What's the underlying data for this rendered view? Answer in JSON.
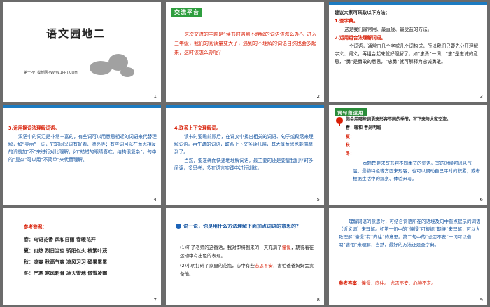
{
  "slides": [
    {
      "num": "1",
      "title": "语文园地二",
      "subtitle": "第一PPT模板网-WWW.1PPT.COM"
    },
    {
      "num": "2",
      "tag": "交流平台",
      "body": "这次交流的主题是“读书时遇到不理解的词语该怎么办”。进入三年级，我们的阅读量变大了，遇到的不理解的词语自然也会多起来，这时该怎么办呢？"
    },
    {
      "num": "3",
      "intro": "建议大家可采取以下方法：",
      "m1": "1.查字典。",
      "m1b": "这是我们最常用、最直接、最受益的方法。",
      "m2": "2.运用组合法理解词语。",
      "m2b": "一个词语，通常由几个字或几个词构成，所以我们只要先分开理解字义、词义，再组合起来就好理解了。如“忠勇”一词，“忠”是忠诚的意思，“勇”是勇敢的意思，“忠勇”就可解释为忠诚勇敢。"
    },
    {
      "num": "4",
      "m3": "3.运用换词法理解词语。",
      "m3b": "汉语中的词汇是非常丰富的，有些词可以用意思相近的词语来代替理解，如“美丽”一词，它的同义词有好看、漂亮等；有些词可以在意思相反的词前加“不”来进行对比理解，如“蜡蜡的眼睛喜欢，结构很复杂”，句中的“复杂”可以用“不简单”来代替理解。"
    },
    {
      "num": "5",
      "m4": "4.联系上下文理解词。",
      "m4b": "读书时要瞻前顾后，在课文中找出相关的词语、句子或段落来理解词语。再生疏的词语，联系上下文多读几遍，其大概意思也能揣摩到了。",
      "m4c": "当然，要准确而快速地理解词语，最主要的还是要靠我们平时多阅读，多思考，多在语言实践中进行训练。"
    },
    {
      "num": "6",
      "tag": "词句段运用",
      "q": "你会用哪些词语来形容不同的季节，写下来与大家交流。",
      "l1": "春：暖和  春光明媚",
      "l2": "夏：",
      "l3": "秋：",
      "l4": "冬：",
      "note": "本题是要求写形容不同季节的词语。写的时候可以从气温、景物特色等方面来形容，也可以调动自己平时的积累，或者根据生活中的观察、体验来写。"
    },
    {
      "num": "7",
      "head": "参考答案：",
      "a1": "春：鸟语花香  风和日丽  春暖花开",
      "a2": "夏：炎热  烈日当空  骄阳似火  枝繁叶茂",
      "a3": "秋：凉爽  秋高气爽  凉风习习  硕果累累",
      "a4": "冬：严寒  寒风刺骨  冰天雪地  傲雪凌霜"
    },
    {
      "num": "8",
      "q": "说一说，你是用什么方法理解下面加点词语的意思的？",
      "s1a": "(1)听了老师的这番话，我对即将到来的一天充满了",
      "s1w": "憧憬",
      "s1b": "，期待着在运动中有出色的表现。",
      "s2a": "(2)小明打碎了家里的花瓶，心中有些",
      "s2w": "忐忑不安",
      "s2b": "，害怕爸爸妈妈会责备他。"
    },
    {
      "num": "9",
      "body": "理解词语的意思时，可结合词语所在的语境及句中重点提示的词语（近义词）来理解。如第一句中的“憧憬”可根据“期待”来理解，可以大致理解“憧憬”有“向往”的意思。第二句中的“忐忑不安”一词可以借助“害怕”来理解，当然，最好的方法还是查字典。",
      "ans_label": "参考答案：",
      "ans": "憧憬：向往。  忐忑不安：心神不定。"
    }
  ]
}
